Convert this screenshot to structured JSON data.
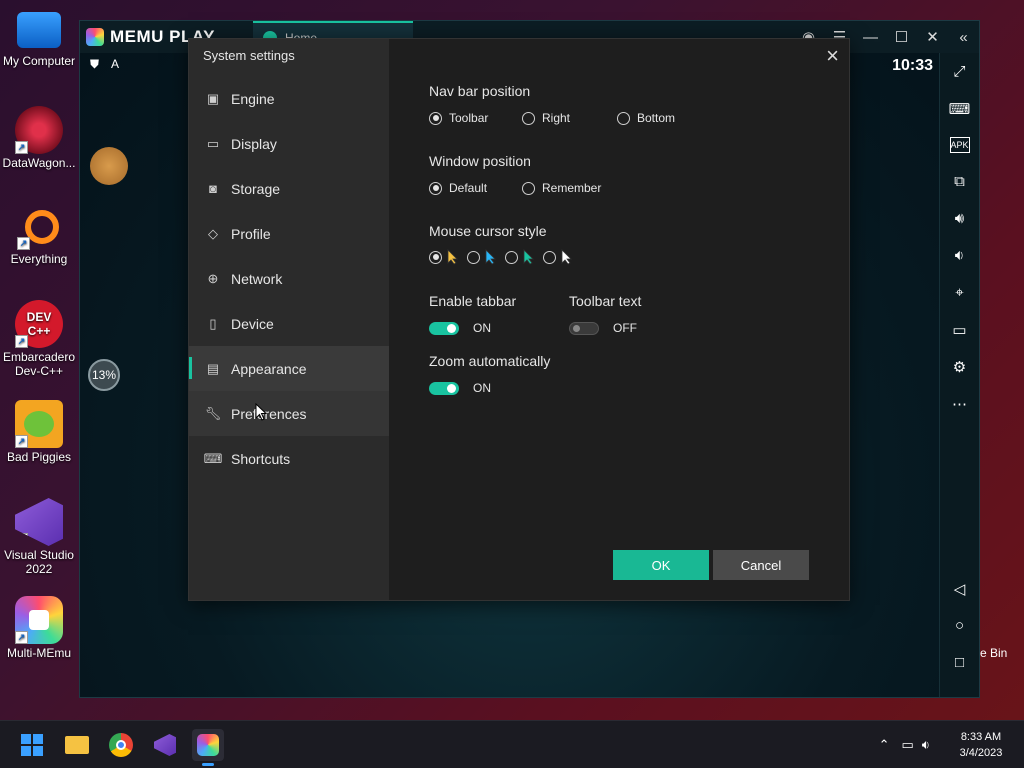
{
  "desktop": {
    "icons": [
      {
        "label": "My Computer"
      },
      {
        "label": "DataWagon..."
      },
      {
        "label": "Everything"
      },
      {
        "label": "Embarcadero Dev-C++"
      },
      {
        "label": "Bad Piggies"
      },
      {
        "label": "Visual Studio 2022"
      },
      {
        "label": "Multi-MEmu"
      }
    ],
    "recycle_label": "e Bin"
  },
  "emulator": {
    "logo": "MEMU PLAY",
    "tab_label": "Home",
    "time": "10:33",
    "progress_badge": "13%"
  },
  "dialog": {
    "title": "System settings",
    "nav": [
      {
        "label": "Engine"
      },
      {
        "label": "Display"
      },
      {
        "label": "Storage"
      },
      {
        "label": "Profile"
      },
      {
        "label": "Network"
      },
      {
        "label": "Device"
      },
      {
        "label": "Appearance"
      },
      {
        "label": "Preferences"
      },
      {
        "label": "Shortcuts"
      }
    ],
    "active_nav": "Appearance",
    "nav_bar_position": {
      "label": "Nav bar position",
      "options": [
        "Toolbar",
        "Right",
        "Bottom"
      ],
      "selected": "Toolbar"
    },
    "window_position": {
      "label": "Window position",
      "options": [
        "Default",
        "Remember"
      ],
      "selected": "Default"
    },
    "mouse_cursor_style": {
      "label": "Mouse cursor style",
      "selected_index": 0
    },
    "enable_tabbar": {
      "label": "Enable tabbar",
      "state": "ON"
    },
    "toolbar_text": {
      "label": "Toolbar text",
      "state": "OFF"
    },
    "zoom_automatically": {
      "label": "Zoom automatically",
      "state": "ON"
    },
    "ok_label": "OK",
    "cancel_label": "Cancel"
  },
  "taskbar": {
    "time": "8:33 AM",
    "date": "3/4/2023"
  },
  "colors": {
    "accent": "#19c3a0",
    "dialog_bg": "#1e1e1e",
    "sidebar_bg": "#2b2b2b"
  }
}
